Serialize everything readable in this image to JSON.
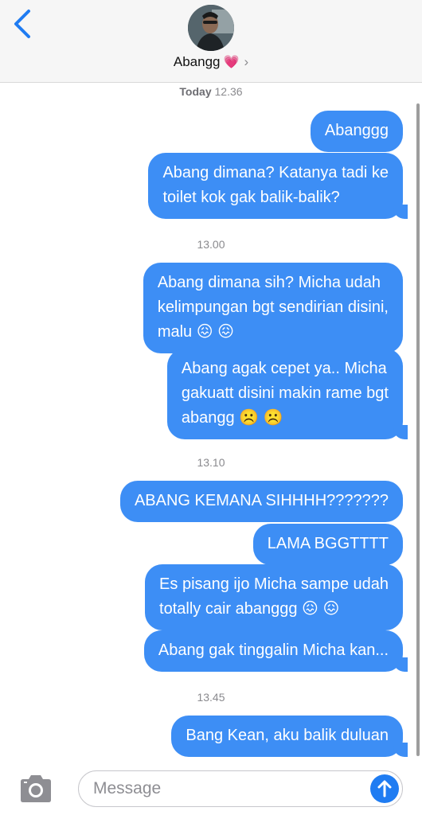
{
  "header": {
    "contact_name": "Abangg",
    "heart_emoji": "💗",
    "chevron": "›",
    "accent_color": "#1f7cf2"
  },
  "thread": {
    "first_timestamp_day": "Today",
    "first_timestamp_time": "12.36",
    "timestamps": [
      "13.00",
      "13.10",
      "13.45"
    ],
    "messages": [
      "Abanggg",
      "Abang dimana? Katanya tadi ke\ntoilet kok gak balik-balik?",
      "Abang dimana sih? Micha udah\nkelimpungan bgt sendirian disini,\nmalu 😖 😖",
      "Abang agak cepet ya.. Micha\ngakuatt disini makin rame bgt\nabangg ☹️ ☹️",
      "ABANG KEMANA SIHHHH???????",
      "LAMA BGGTTTT",
      "Es pisang ijo Micha sampe udah\ntotally cair abanggg 😖 😖",
      "Abang gak tinggalin Micha kan...",
      "Bang Kean, aku balik duluan"
    ],
    "bubble_color": "#3d8ef5"
  },
  "composer": {
    "placeholder": "Message",
    "camera_icon": "camera-icon",
    "send_icon": "arrow-up-icon"
  }
}
